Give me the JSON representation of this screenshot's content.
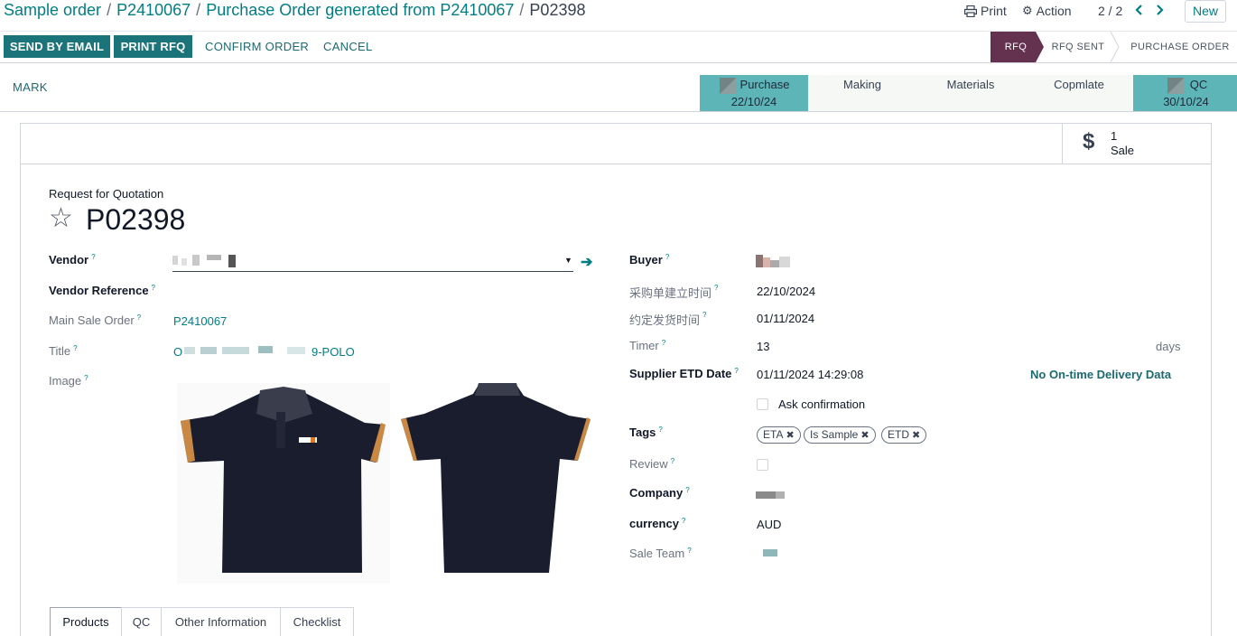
{
  "breadcrumb": {
    "items": [
      "Sample order",
      "P2410067",
      "Purchase Order generated from P2410067"
    ],
    "current": "P02398"
  },
  "topbar": {
    "print_label": "Print",
    "action_label": "Action",
    "pager": "2 / 2",
    "new_label": "New"
  },
  "actions": {
    "send_email": "SEND BY EMAIL",
    "print_rfq": "PRINT RFQ",
    "confirm": "CONFIRM ORDER",
    "cancel": "CANCEL"
  },
  "statusbar": {
    "stages": [
      "RFQ",
      "RFQ SENT",
      "PURCHASE ORDER"
    ],
    "active": "RFQ"
  },
  "progress": {
    "mark_label": "MARK",
    "steps": [
      {
        "label": "Purchase",
        "date": "22/10/24",
        "done": true
      },
      {
        "label": "Making",
        "date": "",
        "done": false
      },
      {
        "label": "Materials",
        "date": "",
        "done": false
      },
      {
        "label": "Copmlate",
        "date": "",
        "done": false
      },
      {
        "label": "QC",
        "date": "30/10/24",
        "done": true
      }
    ]
  },
  "smart_button": {
    "icon": "dollar-icon",
    "count": "1",
    "label": "Sale"
  },
  "form": {
    "subtitle": "Request for Quotation",
    "name": "P02398",
    "left": {
      "vendor_label": "Vendor",
      "vendor_ref_label": "Vendor Reference",
      "main_sale_order_label": "Main Sale Order",
      "main_sale_order_value": "P2410067",
      "title_label": "Title",
      "title_prefix": "O",
      "title_suffix": "9-POLO",
      "image_label": "Image"
    },
    "right": {
      "buyer_label": "Buyer",
      "po_created_label": "采购单建立时间",
      "po_created_value": "22/10/2024",
      "ship_date_label": "约定发货时间",
      "ship_date_value": "01/11/2024",
      "timer_label": "Timer",
      "timer_value": "13",
      "timer_unit": "days",
      "etd_label": "Supplier ETD Date",
      "etd_value": "01/11/2024 14:29:08",
      "delivery_status": "No On-time Delivery Data",
      "ask_confirmation_label": "Ask confirmation",
      "tags_label": "Tags",
      "tags": [
        "ETA",
        "Is Sample",
        "ETD"
      ],
      "review_label": "Review",
      "company_label": "Company",
      "currency_label": "currency",
      "currency_value": "AUD",
      "sale_team_label": "Sale Team"
    },
    "help_mark": "?"
  },
  "tabs": [
    "Products",
    "QC",
    "Other Information",
    "Checklist"
  ],
  "active_tab": "Products",
  "colors": {
    "accent": "#017e84",
    "primary_btn": "#1a747a",
    "stage_active": "#64314f",
    "step_done": "#5eb5b7"
  }
}
